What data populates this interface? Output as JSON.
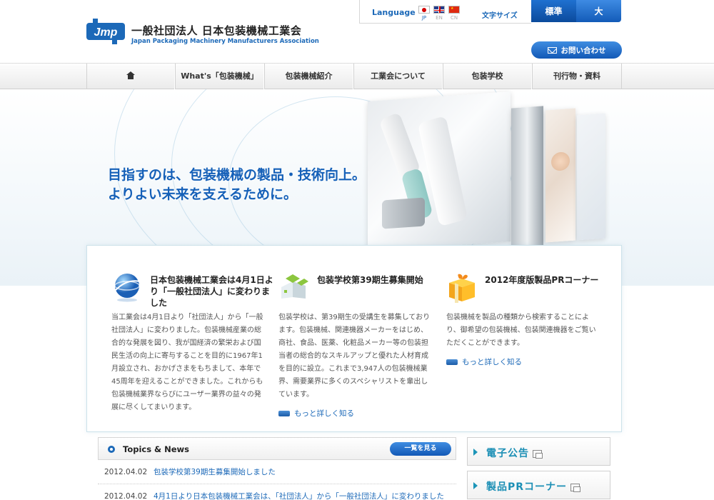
{
  "header": {
    "logo_text": "Jmp",
    "org_name": "一般社団法人 日本包装機械工業会",
    "org_name_en": "Japan Packaging Machinery Manufacturers Association",
    "language_label": "Language",
    "languages": [
      {
        "code": "JP",
        "icon": "japan-flag-icon"
      },
      {
        "code": "EN",
        "icon": "uk-flag-icon"
      },
      {
        "code": "CN",
        "icon": "china-flag-icon"
      }
    ],
    "font_size_label": "文字サイズ",
    "font_size_standard": "標準",
    "font_size_large": "大",
    "contact_label": "お問い合わせ"
  },
  "nav": {
    "items": [
      {
        "label": "",
        "icon": "home-icon"
      },
      {
        "label": "What's「包装機械」"
      },
      {
        "label": "包装機械紹介"
      },
      {
        "label": "工業会について"
      },
      {
        "label": "包装学校"
      },
      {
        "label": "刊行物・資料"
      }
    ]
  },
  "hero": {
    "line1": "目指すのは、包装機械の製品・技術向上。",
    "line2": "よりよい未来を支えるために。"
  },
  "features": [
    {
      "icon": "globe-icon",
      "title": "日本包装機械工業会は4月1日より「一般社団法人」に変わりました",
      "body": "当工業会は4月1日より「社団法人」から「一般社団法人」に変わりました。包装機械産業の総合的な発展を図り、我が国経済の繁栄および国民生活の向上に寄与することを目的に1967年1月設立され、おかげさまをもちまして、本年で45周年を迎えることができました。これからも包装機械業界ならびにユーザー業界の益々の発展に尽くしてまいります。",
      "more": ""
    },
    {
      "icon": "school-building-icon",
      "title": "包装学校第39期生募集開始",
      "body": "包装学校は、第39期生の受講生を募集しております。包装機械、関連機器メーカーをはじめ、商社、食品、医薬、化粧品メーカー等の包装担当者の総合的なスキルアップと優れた人材育成を目的に設立。これまで3,947人の包装機械業界、需要業界に多くのスペシャリストを輩出しています。",
      "more": "もっと詳しく知る"
    },
    {
      "icon": "gift-box-icon",
      "title": "2012年度版製品PRコーナー",
      "body": "包装機械を製品の種類から検索することにより、御希望の包装機械、包装関連機器をご覧いただくことができます。",
      "more": "もっと詳しく知る"
    }
  ],
  "topics": {
    "title": "Topics & News",
    "list_button": "一覧を見る",
    "news": [
      {
        "date": "2012.04.02",
        "text": "包装学校第39期生募集開始しました"
      },
      {
        "date": "2012.04.02",
        "text": "4月1日より日本包装機械工業会は、「社団法人」から「一般社団法人」に変わりました"
      }
    ]
  },
  "side": {
    "e_notice": "電子公告",
    "product_pr": "製品PRコーナー"
  },
  "colors": {
    "brand_blue": "#1c69b8",
    "teal": "#1c8fb5"
  }
}
